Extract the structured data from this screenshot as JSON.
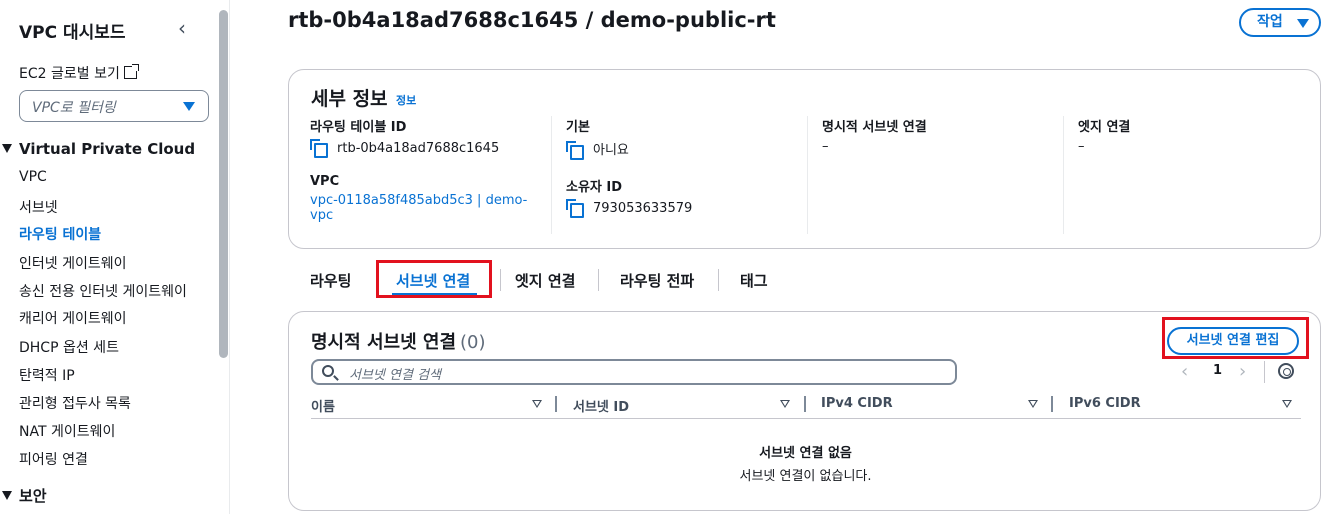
{
  "sidebar": {
    "title": "VPC 대시보드",
    "ec2_link": "EC2 글로벌 보기",
    "filter_placeholder": "VPC로 필터링",
    "section_vpc": "Virtual Private Cloud",
    "items": [
      "VPC",
      "서브넷",
      "라우팅 테이블",
      "인터넷 게이트웨이",
      "송신 전용 인터넷 게이트웨이",
      "캐리어 게이트웨이",
      "DHCP 옵션 세트",
      "탄력적 IP",
      "관리형 접두사 목록",
      "NAT 게이트웨이",
      "피어링 연결"
    ],
    "active_item": "라우팅 테이블",
    "section_security": "보안"
  },
  "header": {
    "title": "rtb-0b4a18ad7688c1645 / demo-public-rt",
    "action_label": "작업"
  },
  "details": {
    "title": "세부 정보",
    "info_link": "정보",
    "route_table_id_label": "라우팅 테이블 ID",
    "route_table_id": "rtb-0b4a18ad7688c1645",
    "vpc_label": "VPC",
    "vpc_value_line1": "vpc-0118a58f485abd5c3 | demo-",
    "vpc_value_line2": "vpc",
    "main_label": "기본",
    "main_value": "아니요",
    "owner_label": "소유자 ID",
    "owner_value": "793053633579",
    "explicit_label": "명시적 서브넷 연결",
    "explicit_value": "–",
    "edge_label": "엣지 연결",
    "edge_value": "–"
  },
  "tabs": [
    "라우팅",
    "서브넷 연결",
    "엣지 연결",
    "라우팅 전파",
    "태그"
  ],
  "active_tab": "서브넷 연결",
  "assoc": {
    "title": "명시적 서브넷 연결",
    "count": "(0)",
    "edit_label": "서브넷 연결 편집",
    "search_placeholder": "서브넷 연결 검색",
    "page": "1",
    "columns": [
      "이름",
      "서브넷 ID",
      "IPv4 CIDR",
      "IPv6 CIDR"
    ],
    "empty_title": "서브넷 연결 없음",
    "empty_sub": "서브넷 연결이 없습니다."
  },
  "colors": {
    "accent": "#0972d3",
    "highlight": "#e2111e"
  }
}
